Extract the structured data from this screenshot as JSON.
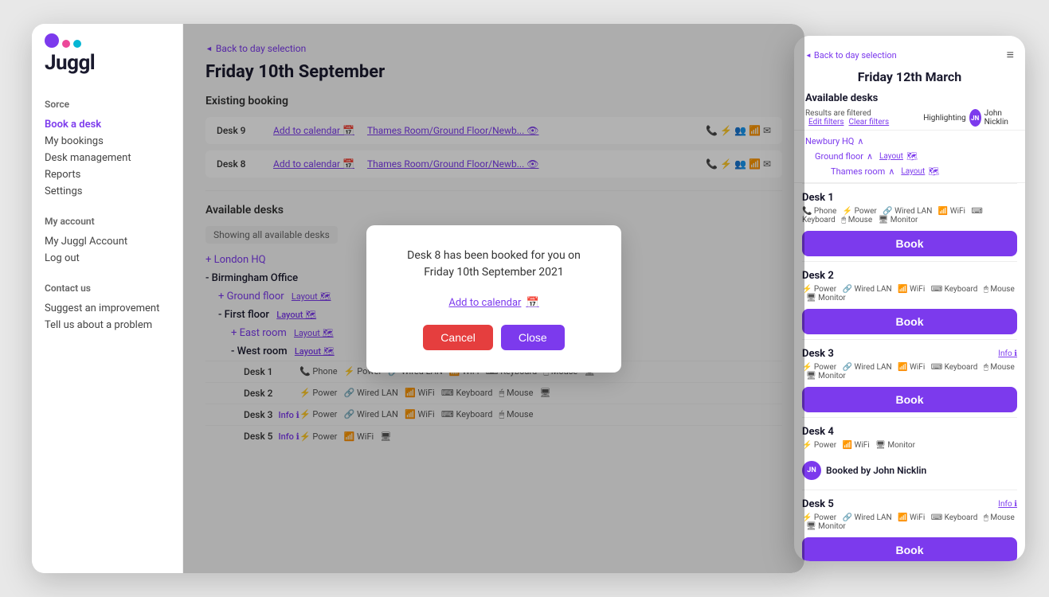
{
  "app": {
    "logo_text": "Juggl"
  },
  "sidebar": {
    "sorce_label": "Sorce",
    "links": [
      {
        "id": "book-desk",
        "label": "Book a desk",
        "active": true
      },
      {
        "id": "my-bookings",
        "label": "My bookings",
        "active": false
      },
      {
        "id": "desk-management",
        "label": "Desk management",
        "active": false
      },
      {
        "id": "reports",
        "label": "Reports",
        "active": false
      },
      {
        "id": "settings",
        "label": "Settings",
        "active": false
      }
    ],
    "my_account_label": "My account",
    "account_links": [
      {
        "id": "my-juggl-account",
        "label": "My Juggl Account"
      },
      {
        "id": "log-out",
        "label": "Log out"
      }
    ],
    "contact_us_label": "Contact us",
    "contact_links": [
      {
        "id": "suggest-improvement",
        "label": "Suggest an improvement"
      },
      {
        "id": "tell-about-problem",
        "label": "Tell us about a problem"
      }
    ]
  },
  "main": {
    "back_link": "Back to day selection",
    "page_title": "Friday 10th September",
    "existing_booking_heading": "Existing booking",
    "bookings": [
      {
        "desk": "Desk 9",
        "add_calendar": "Add to calendar",
        "room_link": "Thames Room/Ground Floor/Newb...",
        "show_icon": "👁"
      },
      {
        "desk": "Desk 8",
        "add_calendar": "Add to calendar",
        "room_link": "Thames Room/Ground Floor/Newb...",
        "show_icon": "👁"
      }
    ],
    "available_desks_heading": "Available desks",
    "showing_label": "Showing all available desks",
    "tree": [
      {
        "type": "expand",
        "indent": 1,
        "label": "+ London HQ"
      },
      {
        "type": "collapse",
        "indent": 1,
        "label": "- Birmingham Office"
      },
      {
        "type": "expand",
        "indent": 2,
        "label": "+ Ground floor",
        "layout_link": "Layout"
      },
      {
        "type": "collapse",
        "indent": 2,
        "label": "- First floor",
        "layout_link": "Layout"
      },
      {
        "type": "expand",
        "indent": 3,
        "label": "+ East room",
        "layout_link": "Layout"
      },
      {
        "type": "collapse",
        "indent": 3,
        "label": "- West room",
        "layout_link": "Layout"
      }
    ],
    "desks": [
      {
        "name": "Desk 1",
        "info": null,
        "amenities": [
          "📞 Phone",
          "⚡ Power",
          "🔗 Wired LAN",
          "📶 WiFi",
          "⌨ Keyboard",
          "🖱 Mouse",
          "🖥"
        ]
      },
      {
        "name": "Desk 2",
        "info": null,
        "amenities": [
          "⚡ Power",
          "🔗 Wired LAN",
          "📶 WiFi",
          "⌨ Keyboard",
          "🖱 Mouse",
          "🖥"
        ]
      },
      {
        "name": "Desk 3",
        "info": "Info",
        "amenities": [
          "⚡ Power",
          "🔗 Wired LAN",
          "📶 WiFi",
          "⌨ Keyboard",
          "🖱 Mouse"
        ]
      },
      {
        "name": "Desk 5",
        "info": "Info",
        "amenities": [
          "⚡ Power",
          "📶 WiFi",
          "🖥"
        ]
      }
    ]
  },
  "modal": {
    "message_line1": "Desk 8 has been booked for you on",
    "message_line2": "Friday 10th September 2021",
    "add_calendar_label": "Add to calendar",
    "cancel_label": "Cancel",
    "close_label": "Close"
  },
  "mobile": {
    "back_label": "Back to day selection",
    "date_title": "Friday 12th March",
    "available_desks_label": "Available desks",
    "filter_text": "Results are filtered",
    "edit_filters_label": "Edit filters",
    "clear_filters_label": "Clear filters",
    "highlighting_label": "Highlighting",
    "user_name": "John Nicklin",
    "location": {
      "hq_label": "Newbury HQ",
      "floor_label": "Ground floor",
      "floor_layout": "Layout",
      "room_label": "Thames room",
      "room_layout": "Layout"
    },
    "desks": [
      {
        "name": "Desk 1",
        "info": null,
        "amenities": [
          "📞 Phone",
          "⚡ Power",
          "🔗 Wired LAN",
          "📶 WiFi",
          "⌨ Keyboard",
          "🖱 Mouse",
          "🖥 Monitor"
        ],
        "status": "available"
      },
      {
        "name": "Desk 2",
        "info": null,
        "amenities": [
          "⚡ Power",
          "🔗 Wired LAN",
          "📶 WiFi",
          "⌨ Keyboard",
          "🖱 Mouse",
          "🖥 Monitor"
        ],
        "status": "available"
      },
      {
        "name": "Desk 3",
        "info": "Info",
        "amenities": [
          "⚡ Power",
          "🔗 Wired LAN",
          "📶 WiFi",
          "⌨ Keyboard",
          "🖱 Mouse",
          "🖥 Monitor"
        ],
        "status": "available"
      },
      {
        "name": "Desk 4",
        "info": null,
        "amenities": [
          "⚡ Power",
          "📶 WiFi",
          "🖥 Monitor"
        ],
        "status": "booked",
        "booked_by": "Booked by John Nicklin"
      },
      {
        "name": "Desk 5",
        "info": "Info",
        "amenities": [
          "⚡ Power",
          "🔗 Wired LAN",
          "📶 WiFi",
          "⌨ Keyboard",
          "🖱 Mouse",
          "🖥 Monitor"
        ],
        "status": "available"
      }
    ],
    "book_label": "Book"
  }
}
